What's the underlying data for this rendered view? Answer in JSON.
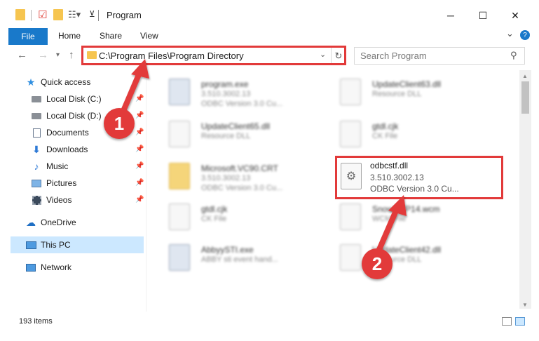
{
  "window": {
    "title": "Program",
    "minimize": "─",
    "maximize": "☐",
    "close": "✕"
  },
  "ribbon": {
    "tabs": [
      "File",
      "Home",
      "Share",
      "View"
    ],
    "expand": "⌄",
    "help": "?"
  },
  "address": {
    "path": "C:\\Program Files\\Program Directory",
    "search_placeholder": "Search Program"
  },
  "sidebar": {
    "items": [
      {
        "label": "Quick access",
        "icon": "star-icon"
      },
      {
        "label": "Local Disk (C:)",
        "icon": "drive-icon"
      },
      {
        "label": "Local Disk (D:)",
        "icon": "drive-icon"
      },
      {
        "label": "Documents",
        "icon": "documents-icon"
      },
      {
        "label": "Downloads",
        "icon": "downloads-icon"
      },
      {
        "label": "Music",
        "icon": "music-icon"
      },
      {
        "label": "Pictures",
        "icon": "pictures-icon"
      },
      {
        "label": "Videos",
        "icon": "videos-icon"
      },
      {
        "label": "OneDrive",
        "icon": "cloud-icon"
      },
      {
        "label": "This PC",
        "icon": "computer-icon"
      },
      {
        "label": "Network",
        "icon": "network-icon"
      }
    ]
  },
  "files": [
    {
      "name": "program.exe",
      "line2": "3.510.3002.13",
      "line3": "ODBC Version 3.0 Cu...",
      "kind": "exe"
    },
    {
      "name": "UpdateClient63.dll",
      "line2": "Resource DLL",
      "line3": "",
      "kind": "dll"
    },
    {
      "name": "UpdateClient65.dll",
      "line2": "Resource DLL",
      "line3": "",
      "kind": "dll"
    },
    {
      "name": "gtdl.cjk",
      "line2": "CK File",
      "line3": "",
      "kind": "file"
    },
    {
      "name": "Microsoft.VC90.CRT",
      "line2": "3.510.3002.13",
      "line3": "ODBC Version 3.0 Cu...",
      "kind": "folder"
    },
    {
      "name": "gtdl.cjk",
      "line2": "CK File",
      "line3": "",
      "kind": "file"
    },
    {
      "name": "Snowb TP14.wcm",
      "line2": "WCM File",
      "line3": "",
      "kind": "file"
    },
    {
      "name": "AbbyySTI.exe",
      "line2": "ABBY sti event hand...",
      "line3": "",
      "kind": "exe"
    },
    {
      "name": "UpdateClient42.dll",
      "line2": "Resource DLL",
      "line3": "",
      "kind": "dll"
    }
  ],
  "highlight_file": {
    "name": "odbcstf.dll",
    "version": "3.510.3002.13",
    "description": "ODBC Version 3.0 Cu..."
  },
  "status": {
    "item_count": "193 items"
  },
  "annotations": {
    "step1": "1",
    "step2": "2",
    "color": "#e23a3a"
  }
}
